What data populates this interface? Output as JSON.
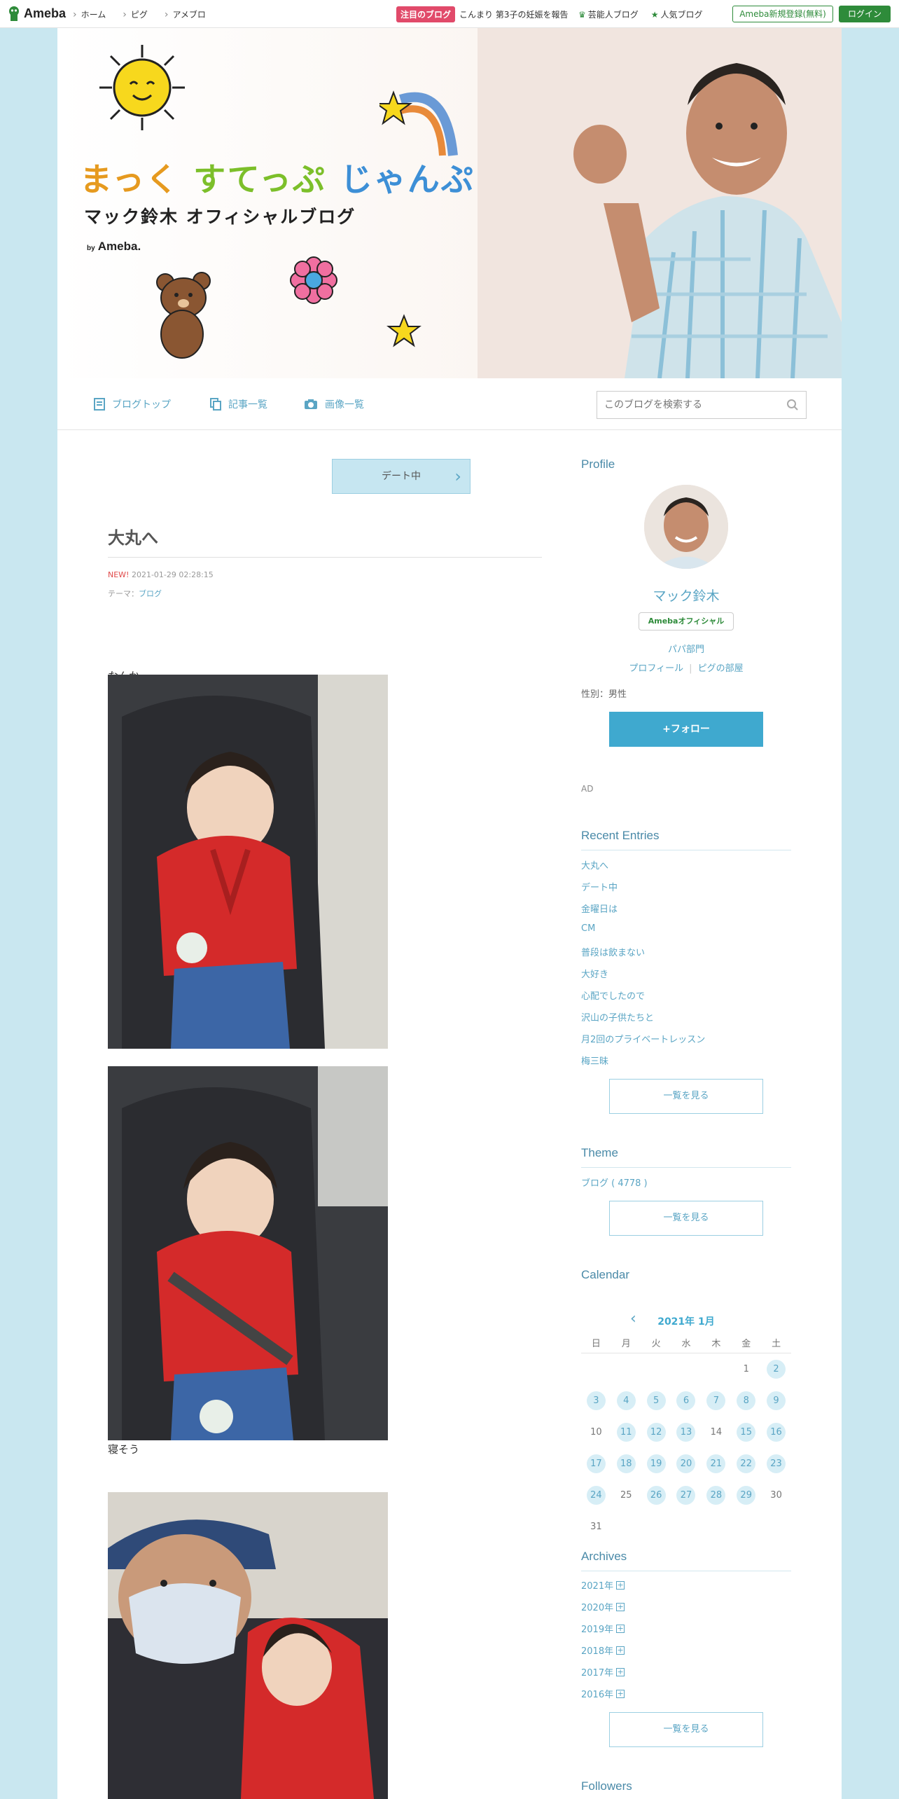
{
  "topbar": {
    "logo_text": "Ameba",
    "nav": [
      "ホーム",
      "ピグ",
      "アメブロ"
    ],
    "featured_badge": "注目のブログ",
    "featured_text": "こんまり 第3子の妊娠を報告",
    "celeb_blog": "芸能人ブログ",
    "popular_blog": "人気ブログ",
    "register": "Ameba新規登録(無料)",
    "login": "ログイン"
  },
  "banner": {
    "title_1": "まっく",
    "title_2": "すてっぷ",
    "title_3": "じゃんぷ",
    "subtitle": "マック鈴木 オフィシャルブログ",
    "by": "by",
    "by_brand": "Ameba."
  },
  "blognav": {
    "top": "ブログトップ",
    "entries": "記事一覧",
    "images": "画像一覧",
    "search_placeholder": "このブログを検索する"
  },
  "article": {
    "prev_entry": "デート中",
    "title": "大丸へ",
    "new_label": "NEW!",
    "datetime": "2021-01-29 02:28:15",
    "theme_label": "テーマ：",
    "theme": "ブログ",
    "text_1": "なんか",
    "text_2": "寝そう"
  },
  "profile": {
    "heading": "Profile",
    "name": "マック鈴木",
    "official": "Amebaオフィシャル",
    "category": "パパ部門",
    "link_profile": "プロフィール",
    "link_pig": "ピグの部屋",
    "gender": "性別：男性",
    "follow": "+フォロー",
    "ad": "AD"
  },
  "recent": {
    "heading": "Recent Entries",
    "items": [
      "大丸へ",
      "デート中",
      "金曜日は",
      "CM",
      "普段は飲まない",
      "大好き",
      "心配でしたので",
      "沢山の子供たちと",
      "月2回のプライベートレッスン",
      "梅三昧"
    ],
    "more": "一覧を見る"
  },
  "theme": {
    "heading": "Theme",
    "item": "ブログ ( 4778 )",
    "more": "一覧を見る"
  },
  "calendar": {
    "heading": "Calendar",
    "month": "2021年 1月",
    "dow": [
      "日",
      "月",
      "火",
      "水",
      "木",
      "金",
      "土"
    ],
    "weeks": [
      [
        "",
        "",
        "",
        "",
        "",
        "1",
        "2"
      ],
      [
        "3",
        "4",
        "5",
        "6",
        "7",
        "8",
        "9"
      ],
      [
        "10",
        "11",
        "12",
        "13",
        "14",
        "15",
        "16"
      ],
      [
        "17",
        "18",
        "19",
        "20",
        "21",
        "22",
        "23"
      ],
      [
        "24",
        "25",
        "26",
        "27",
        "28",
        "29",
        "30"
      ],
      [
        "31",
        "",
        "",
        "",
        "",
        "",
        ""
      ]
    ],
    "posted_days": [
      "2",
      "3",
      "4",
      "5",
      "6",
      "7",
      "8",
      "9",
      "11",
      "12",
      "13",
      "15",
      "16",
      "17",
      "18",
      "19",
      "20",
      "21",
      "22",
      "23",
      "24",
      "26",
      "27",
      "28",
      "29"
    ]
  },
  "archives": {
    "heading": "Archives",
    "years": [
      "2021年",
      "2020年",
      "2019年",
      "2018年",
      "2017年",
      "2016年"
    ],
    "more": "一覧を見る"
  },
  "followers": {
    "heading": "Followers"
  },
  "colors": {
    "page_bg": "#c9e7f0",
    "accent": "#3fa9cf",
    "link": "#5aa5c4",
    "ameba_green": "#2e8b3a",
    "badge_pink": "#e14a6a"
  }
}
